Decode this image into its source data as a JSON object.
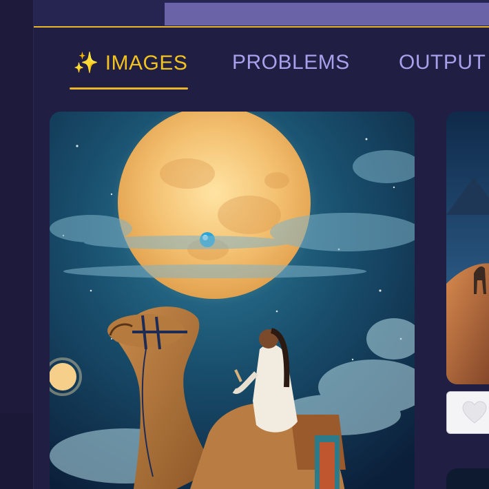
{
  "tabs": [
    {
      "icon": "sparkles-icon",
      "glyph": "✨",
      "label": "IMAGES",
      "active": true
    },
    {
      "label": "PROBLEMS",
      "active": false
    },
    {
      "label": "OUTPUT",
      "active": false
    }
  ],
  "progress": {
    "percent": 71
  },
  "colors": {
    "background": "#211e44",
    "accent": "#f2c21f",
    "tab_inactive": "#a8a0ea",
    "progress_fill": "#6a63a7"
  },
  "gallery": {
    "main_image": "painting-woman-riding-camel-under-full-moon",
    "side_image": "painting-camel-caravan-in-desert",
    "like_icon": "heart-icon"
  }
}
